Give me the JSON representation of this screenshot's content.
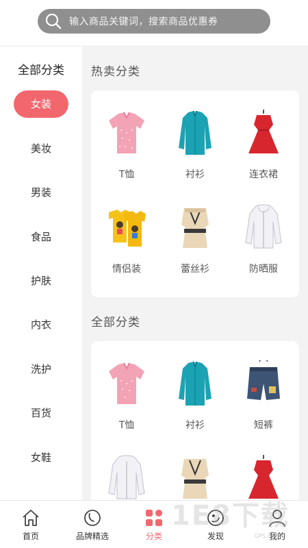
{
  "search": {
    "placeholder": "输入商品关键词，搜索商品优惠券",
    "icon": "search-icon"
  },
  "sidebar": {
    "title": "全部分类",
    "items": [
      {
        "label": "女装",
        "active": true
      },
      {
        "label": "美妆"
      },
      {
        "label": "男装"
      },
      {
        "label": "食品"
      },
      {
        "label": "护肤"
      },
      {
        "label": "内衣"
      },
      {
        "label": "洗护"
      },
      {
        "label": "百货"
      },
      {
        "label": "女鞋"
      }
    ],
    "accent_color": "#f2676e"
  },
  "hot": {
    "title": "热卖分类",
    "items": [
      {
        "label": "T恤",
        "icon": "pink-polo-shirt-icon"
      },
      {
        "label": "衬衫",
        "icon": "teal-shirt-icon"
      },
      {
        "label": "连衣裙",
        "icon": "red-dress-icon"
      },
      {
        "label": "情侣装",
        "icon": "yellow-couple-tshirt-icon"
      },
      {
        "label": "蕾丝衫",
        "icon": "lace-blouse-icon"
      },
      {
        "label": "防晒服",
        "icon": "white-jacket-icon"
      }
    ]
  },
  "all": {
    "title": "全部分类",
    "items": [
      {
        "label": "T恤",
        "icon": "pink-polo-shirt-icon"
      },
      {
        "label": "衬衫",
        "icon": "teal-shirt-icon"
      },
      {
        "label": "短裤",
        "icon": "denim-shorts-icon"
      },
      {
        "label": "",
        "icon": "white-jacket-icon"
      },
      {
        "label": "",
        "icon": "lace-blouse-icon"
      },
      {
        "label": "",
        "icon": "red-dress-icon"
      }
    ]
  },
  "tabbar": {
    "items": [
      {
        "label": "首页",
        "icon": "home-icon"
      },
      {
        "label": "品牌精选",
        "icon": "brand-icon"
      },
      {
        "label": "分类",
        "icon": "category-grid-icon",
        "active": true
      },
      {
        "label": "发现",
        "icon": "discover-icon"
      },
      {
        "label": "我的",
        "icon": "profile-icon"
      }
    ]
  },
  "watermark": {
    "text": "1E8下载",
    "sub": "GPS.com"
  }
}
